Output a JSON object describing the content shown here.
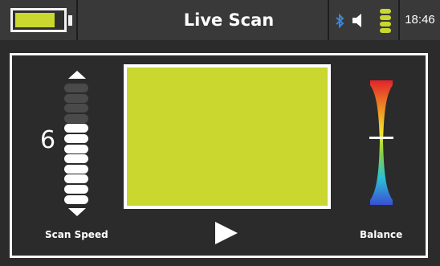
{
  "status_bar": {
    "title": "Live Scan",
    "time": "18:46",
    "battery_level": 0.85,
    "bluetooth_icon": "bluetooth-icon",
    "speaker_icon": "speaker-icon",
    "signal_icon": "signal-icon"
  },
  "scan_speed": {
    "value": "6",
    "label": "Scan Speed",
    "total_segments": 12,
    "active_segments": 8
  },
  "display": {
    "fill_color": "#c9d72f",
    "play_icon": "play-icon"
  },
  "balance": {
    "label": "Balance",
    "position": 0.45
  },
  "colors": {
    "accent": "#c9d72f",
    "background": "#2b2b2b",
    "status_bar": "#393939",
    "inactive_segment": "#4a4a4a"
  }
}
